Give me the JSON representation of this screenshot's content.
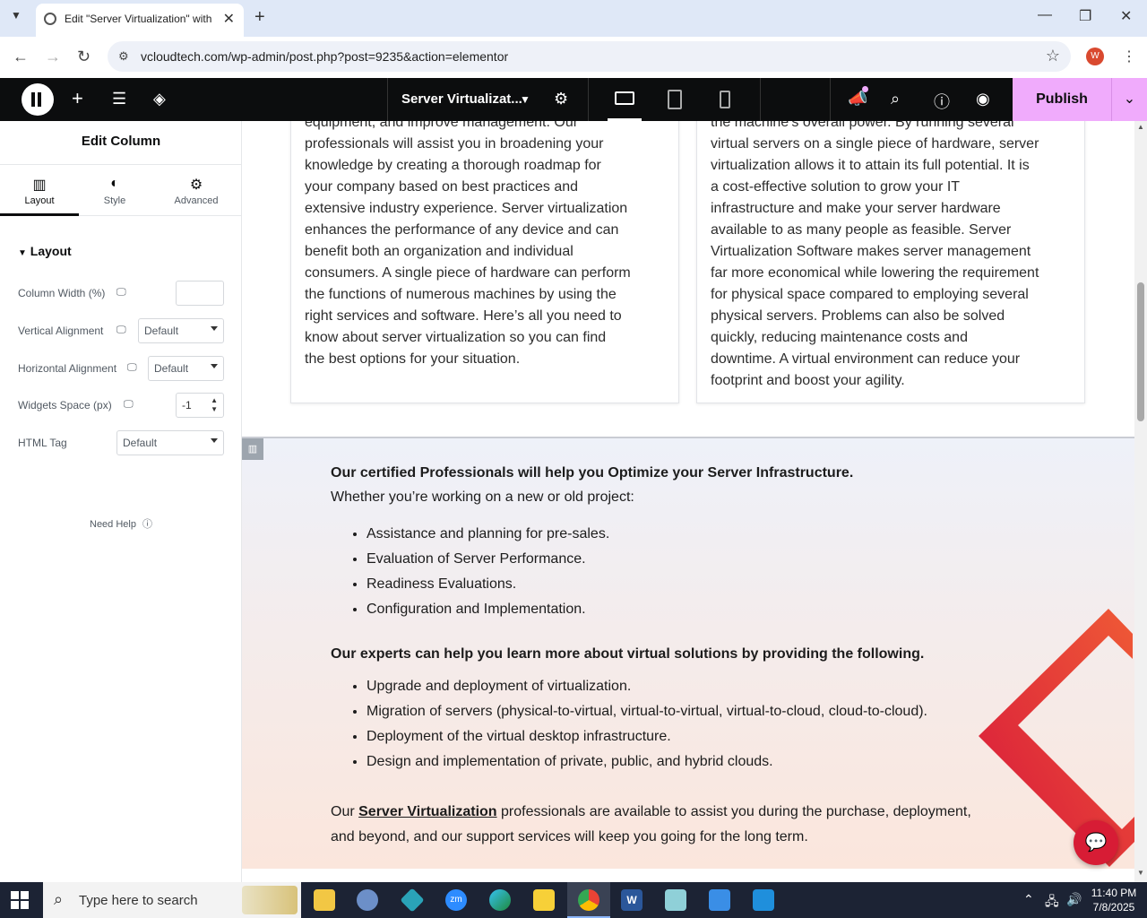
{
  "browser": {
    "tab_title": "Edit \"Server Virtualization\" with",
    "url": "vcloudtech.com/wp-admin/post.php?post=9235&action=elementor",
    "profile_initial": "W"
  },
  "editor": {
    "doc_title": "Server Virtualizat...",
    "publish_label": "Publish"
  },
  "panel": {
    "title": "Edit Column",
    "tabs": [
      {
        "label": "Layout",
        "icon": "layout-icon"
      },
      {
        "label": "Style",
        "icon": "style-icon"
      },
      {
        "label": "Advanced",
        "icon": "gear-icon"
      }
    ],
    "section_label": "Layout",
    "controls": {
      "column_width_label": "Column Width (%)",
      "column_width_value": "",
      "vertical_alignment_label": "Vertical Alignment",
      "vertical_alignment_value": "Default",
      "horizontal_alignment_label": "Horizontal Alignment",
      "horizontal_alignment_value": "Default",
      "widgets_space_label": "Widgets Space (px)",
      "widgets_space_value": "-1",
      "html_tag_label": "HTML Tag",
      "html_tag_value": "Default"
    },
    "need_help": "Need Help"
  },
  "content": {
    "left_card_lines": [
      "equipment, and improve management. Our",
      "professionals will assist you in broadening your",
      "knowledge by creating a thorough roadmap for",
      "your company based on best practices and",
      "extensive industry experience. Server virtualization",
      "enhances the performance of any device and can",
      "benefit both an organization and individual",
      "consumers. A single piece of hardware can perform",
      "the functions of numerous machines by using the",
      "right services and software. Here’s all you need to",
      "know about server virtualization so you can find",
      "the best options for your situation."
    ],
    "right_card_lines": [
      "the machine’s overall power. By running several",
      "virtual servers on a single piece of hardware, server",
      "virtualization allows it to attain its full potential. It is",
      "a cost-effective solution to grow your IT",
      "infrastructure and make your server hardware",
      "available to as many people as feasible. Server",
      "Virtualization Software makes server management",
      "far more economical while lowering the requirement",
      "for physical space compared to employing several",
      "physical servers. Problems can also be solved",
      "quickly, reducing maintenance costs and",
      "downtime. A virtual environment can reduce your",
      "footprint and boost your agility."
    ],
    "heading1": "Our certified Professionals will help you Optimize your Server Infrastructure.",
    "intro": "Whether you’re working on a new or old project:",
    "list1": [
      "Assistance and planning for pre-sales.",
      "Evaluation of Server Performance.",
      "Readiness Evaluations.",
      "Configuration and Implementation."
    ],
    "heading2": "Our experts can help you learn more about virtual solutions by providing the following.",
    "list2": [
      "Upgrade and deployment of virtualization.",
      "Migration of servers (physical-to-virtual, virtual-to-virtual, virtual-to-cloud, cloud-to-cloud).",
      "Deployment of the virtual desktop infrastructure.",
      "Design and implementation of private, public, and hybrid clouds."
    ],
    "closing_prefix": "Our ",
    "closing_link": "Server Virtualization",
    "closing_suffix": " professionals are available to assist you during the purchase, deployment,",
    "closing_line2": "and beyond, and our support services will keep you going for the long term."
  },
  "taskbar": {
    "search_placeholder": "Type here to search",
    "time": "11:40 PM",
    "date": "7/8/2025"
  },
  "colors": {
    "publish_bg": "#f0abfc",
    "editor_bar": "#0c0d0e",
    "accent_red": "#d71c35"
  }
}
